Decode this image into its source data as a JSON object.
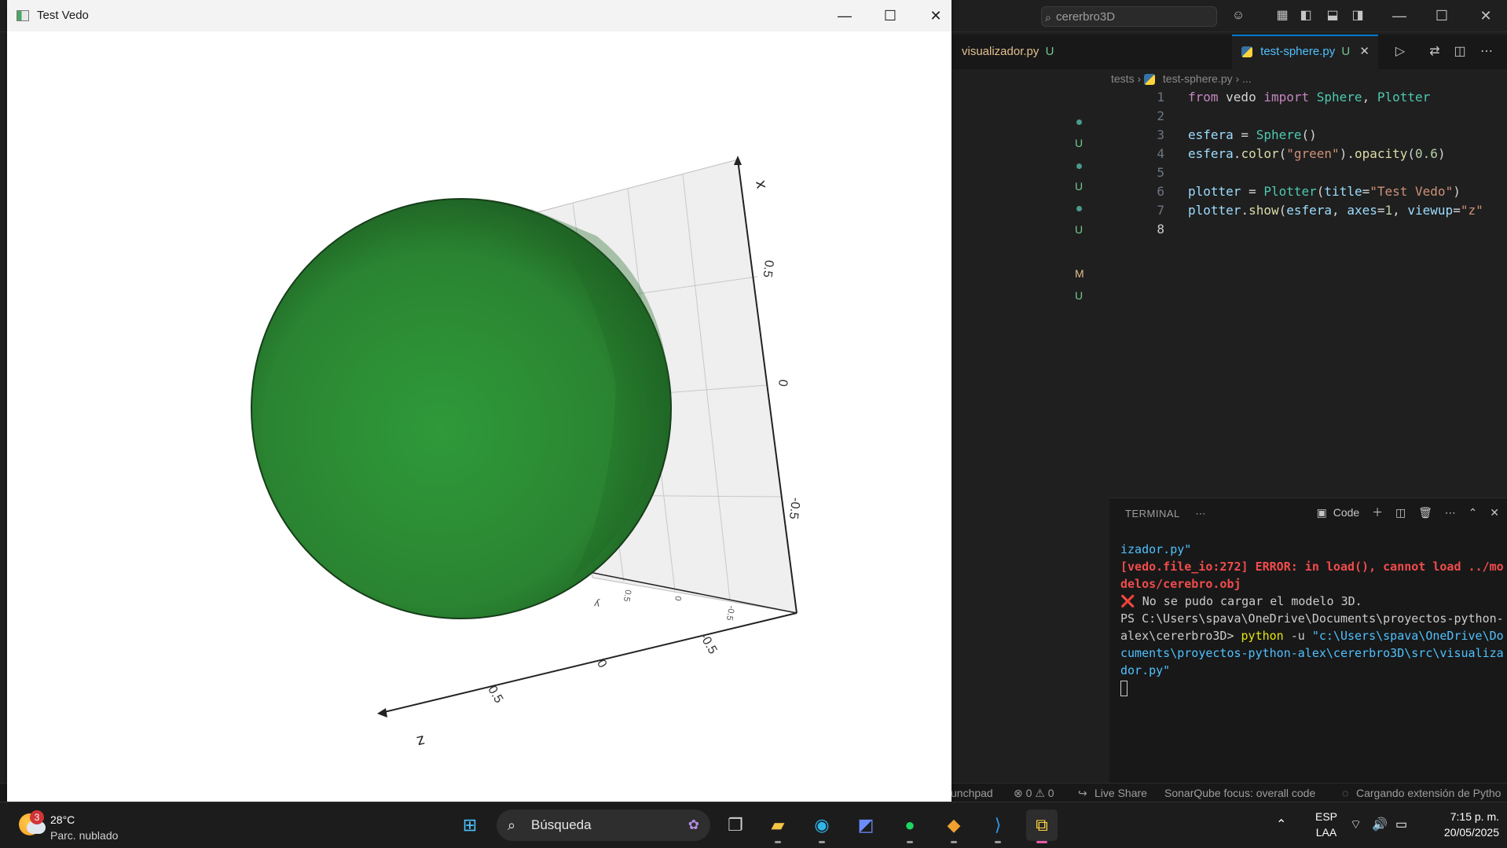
{
  "vedo_window": {
    "title": "Test Vedo",
    "controls": {
      "minimize": "—",
      "maximize": "☐",
      "close": "✕"
    },
    "axes": {
      "x_label": "x",
      "z_label": "z",
      "x_ticks": [
        "0.5",
        "0",
        "-0.5"
      ],
      "z_ticks": [
        "0.5",
        "0",
        "-0.5"
      ],
      "y_ticks": [
        "y",
        "0.5",
        "0",
        "-0.5"
      ]
    },
    "sphere_color": "#2c8a34",
    "sphere_opacity": 0.6
  },
  "vscode": {
    "command_center": "cererbro3D",
    "tabs": [
      {
        "label": "visualizador.py",
        "status": "U"
      },
      {
        "label": "test-sphere.py",
        "status": "U"
      }
    ],
    "breadcrumb": [
      "tests",
      "test-sphere.py",
      "..."
    ],
    "scm_markers": [
      "U",
      "U",
      "U",
      "M",
      "U"
    ],
    "code_lines": [
      "from vedo import Sphere, Plotter",
      "",
      "esfera = Sphere()",
      "esfera.color(\"green\").opacity(0.6)",
      "",
      "plotter = Plotter(title=\"Test Vedo\")",
      "plotter.show(esfera, axes=1, viewup=\"z\"",
      ""
    ],
    "terminal": {
      "tab_label": "TERMINAL",
      "shell_label": "Code",
      "lines": [
        {
          "text": "izador.py\"",
          "style": "blue"
        },
        {
          "text": "[vedo.file_io:272] ERROR: in load(), cannot load ../modelos/cerebro.obj",
          "style": "red"
        },
        {
          "text": "❌ No se pudo cargar el modelo 3D.",
          "style": "plain"
        },
        {
          "text": "PS C:\\Users\\spava\\OneDrive\\Documents\\proyectos-python-alex\\cererbro3D> ",
          "style": "plain"
        },
        {
          "text": "python",
          "style": "yellow"
        },
        {
          "text": " -u ",
          "style": "plain"
        },
        {
          "text": "\"c:\\Users\\spava\\OneDrive\\Documents\\proyectos-python-alex\\cererbro3D\\src\\visualizador.py\"",
          "style": "blue"
        }
      ]
    },
    "status_bar": {
      "launchpad": "unchpad",
      "problems": "⊗ 0 ⚠ 0",
      "live_share": "Live Share",
      "sonar": "SonarQube focus: overall code",
      "loading": "Cargando extensión de Pytho"
    }
  },
  "taskbar": {
    "weather_temp": "28°C",
    "weather_desc": "Parc. nublado",
    "weather_badge": "3",
    "search_placeholder": "Búsqueda",
    "lang_top": "ESP",
    "lang_bottom": "LAA",
    "time": "7:15 p. m.",
    "date": "20/05/2025"
  }
}
